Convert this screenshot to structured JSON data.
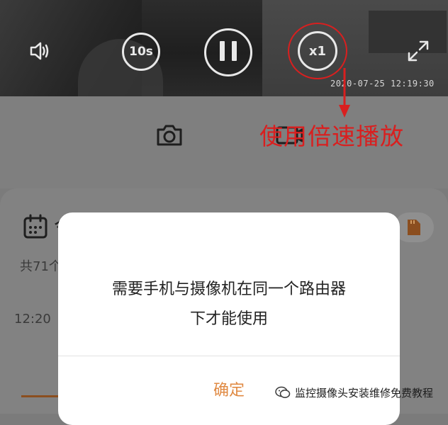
{
  "player": {
    "rewind_label": "10s",
    "speed_label": "x1",
    "timestamp": "2020-07-25 12:19:30",
    "icons": {
      "speaker": "speaker-icon",
      "rewind": "rewind-10s-icon",
      "pause": "pause-icon",
      "speed": "speed-icon",
      "fullscreen": "fullscreen-icon"
    }
  },
  "annotation": {
    "text": "使用倍速播放",
    "color": "#d91f1f"
  },
  "toolbar": {
    "icons": {
      "snapshot": "camera-icon",
      "record": "record-icon"
    }
  },
  "card": {
    "heading_fragment": "今",
    "count_fragment": "共71个",
    "time_label": "12:20",
    "icons": {
      "calendar": "calendar-icon",
      "sd_card": "sd-card-icon"
    }
  },
  "dialog": {
    "message_line1": "需要手机与摄像机在同一个路由器",
    "message_line2": "下才能使用",
    "confirm_label": "确定",
    "accent": "#e08a43"
  },
  "watermark": {
    "text": "监控摄像头安装维修免费教程"
  }
}
